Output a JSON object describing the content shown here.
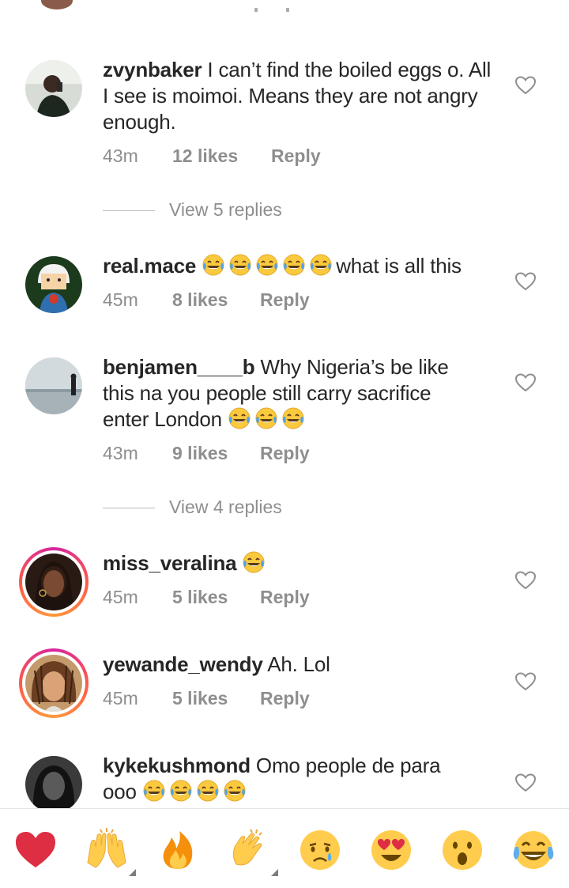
{
  "comments": [
    {
      "username": "zvynbaker",
      "text": "I can’t find the boiled eggs o. All I see is moimoi. Means they are not angry enough.",
      "time": "43m",
      "likes": "12 likes",
      "reply": "Reply"
    },
    {
      "username": "real.mace",
      "text": "what is all this",
      "time": "45m",
      "likes": "8 likes",
      "reply": "Reply"
    },
    {
      "username": "benjamen____b",
      "text_line1": "Why Nigeria’s be like",
      "text_line2": "this na you people still carry sacrifice",
      "text_line3": "enter London",
      "time": "43m",
      "likes": "9 likes",
      "reply": "Reply"
    },
    {
      "username": "miss_veralina",
      "time": "45m",
      "likes": "5 likes",
      "reply": "Reply"
    },
    {
      "username": "yewande_wendy",
      "text": "Ah. Lol",
      "time": "45m",
      "likes": "5 likes",
      "reply": "Reply"
    },
    {
      "username": "kykekushmond",
      "text_line1": "Omo people de para",
      "text_line2": "ooo"
    }
  ],
  "view_replies": [
    "View 5 replies",
    "View 4 replies"
  ],
  "reactions": [
    "red-heart",
    "raising-hands",
    "fire",
    "clapping-hands",
    "crying-face",
    "heart-eyes",
    "surprised-face",
    "tears-of-joy"
  ],
  "colors": {
    "text": "#262626",
    "meta": "#8e8e8e",
    "story_ring": "#d6249f"
  }
}
